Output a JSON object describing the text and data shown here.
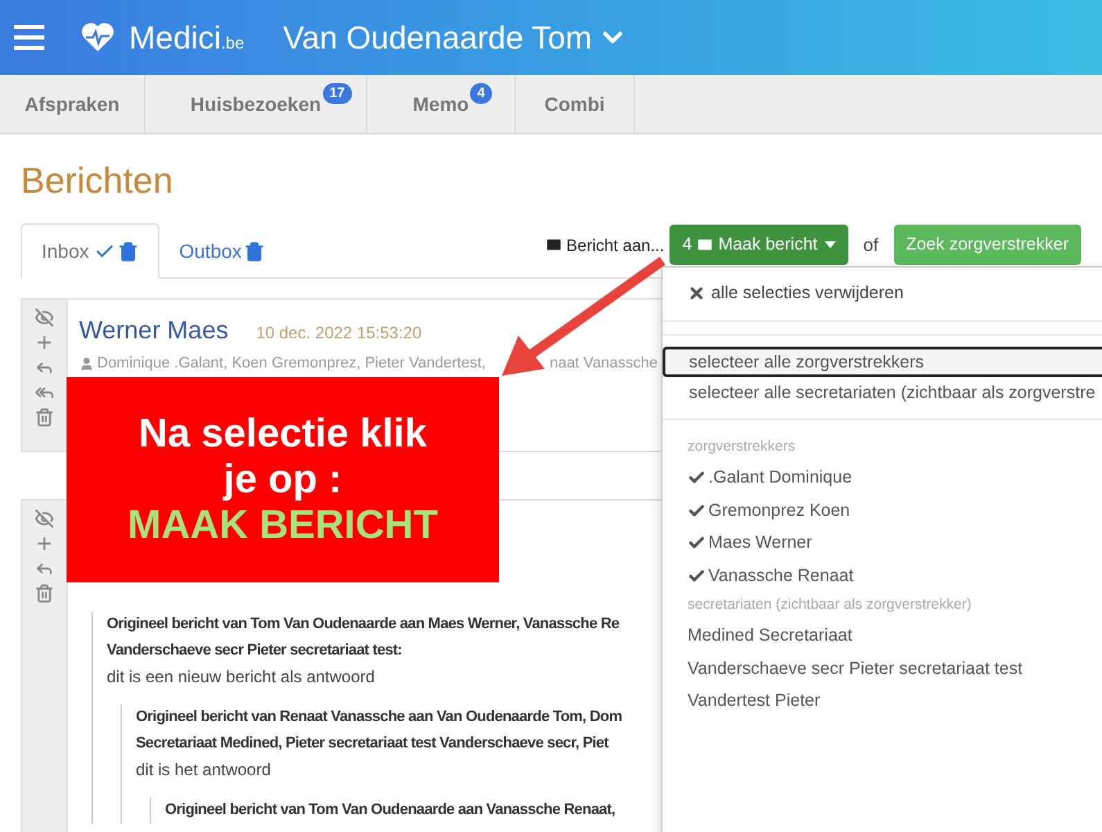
{
  "header": {
    "logo_main": "Medici",
    "logo_suffix": ".be",
    "user": "Van Oudenaarde Tom"
  },
  "nav_tabs": [
    {
      "label": "Afspraken"
    },
    {
      "label": "Huisbezoeken",
      "badge": "17"
    },
    {
      "label": "Memo",
      "badge": "4"
    },
    {
      "label": "Combi"
    }
  ],
  "page_title": "Berichten",
  "mail_tabs": [
    {
      "label": "Inbox",
      "selected": true,
      "checked": true
    },
    {
      "label": "Outbox",
      "selected": false,
      "checked": false
    }
  ],
  "toolbar": {
    "recipient_label": "Bericht aan...",
    "compose_count": "4",
    "compose_label": "Maak bericht",
    "separator": "of",
    "search_button": "Zoek zorgverstrekker"
  },
  "dropdown": {
    "clear": "alle selecties verwijderen",
    "actions": [
      {
        "label": "selecteer alle zorgverstrekkers",
        "focused": true
      },
      {
        "label": "selecteer alle secretariaten (zichtbaar als zorgverstre",
        "focused": false
      }
    ],
    "groups": [
      {
        "header": "zorgverstrekkers",
        "items": [
          {
            "label": ".Galant Dominique",
            "checked": true
          },
          {
            "label": "Gremonprez Koen",
            "checked": true
          },
          {
            "label": "Maes Werner",
            "checked": true
          },
          {
            "label": "Vanassche Renaat",
            "checked": true
          }
        ]
      },
      {
        "header": "secretariaten (zichtbaar als zorgverstrekker)",
        "items": [
          {
            "label": "Medined Secretariaat",
            "checked": false
          },
          {
            "label": "Vanderschaeve secr Pieter secretariaat test",
            "checked": false
          },
          {
            "label": "Vandertest Pieter",
            "checked": false
          }
        ]
      }
    ]
  },
  "messages": [
    {
      "sender": "Werner Maes",
      "date": "10 dec. 2022 15:53:20",
      "recipients": [
        "Dominique .Galant, Koen Gremonprez, Pieter Vandertest,",
        "naat Vanassche"
      ],
      "reply_all": true
    },
    {
      "reply_all": false,
      "quotes": [
        {
          "heading": [
            "Origineel bericht van Tom Van Oudenaarde aan Maes Werner, Vanassche Re",
            "Vanderschaeve secr Pieter secretariaat test:"
          ],
          "body": "dit is een nieuw bericht als antwoord",
          "children": [
            {
              "heading": [
                "Origineel bericht van Renaat Vanassche aan Van Oudenaarde Tom, Dom",
                "Secretariaat Medined, Pieter secretariaat test Vanderschaeve secr, Piet"
              ],
              "body": "dit is het antwoord",
              "children": [
                {
                  "heading": [
                    "Origineel bericht van Tom Van Oudenaarde aan Vanassche Renaat,"
                  ]
                }
              ]
            }
          ]
        }
      ]
    }
  ],
  "annotation": {
    "lines": [
      "Na selectie klik",
      "je op :"
    ],
    "highlight": "MAAK BERICHT"
  }
}
